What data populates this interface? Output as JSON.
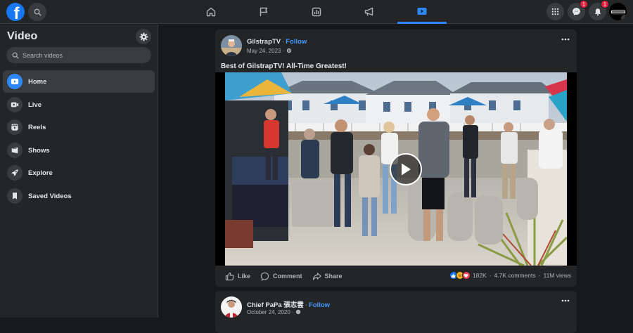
{
  "topbar": {
    "logo_letter": "f",
    "tabs": [
      {
        "name": "home",
        "active": false
      },
      {
        "name": "pages",
        "active": false
      },
      {
        "name": "ads-manager",
        "active": false
      },
      {
        "name": "campaigns",
        "active": false
      },
      {
        "name": "video",
        "active": true
      }
    ],
    "messenger_badge": "1",
    "notifications_badge": "1",
    "accent_color": "#2d88ff"
  },
  "sidebar": {
    "title": "Video",
    "search_placeholder": "Search videos",
    "items": [
      {
        "label": "Home",
        "icon": "video-home-icon",
        "active": true
      },
      {
        "label": "Live",
        "icon": "live-icon",
        "active": false
      },
      {
        "label": "Reels",
        "icon": "reels-icon",
        "active": false
      },
      {
        "label": "Shows",
        "icon": "shows-icon",
        "active": false
      },
      {
        "label": "Explore",
        "icon": "rocket-icon",
        "active": false
      },
      {
        "label": "Saved Videos",
        "icon": "bookmark-icon",
        "active": false
      }
    ]
  },
  "posts": [
    {
      "author": "GilstrapTV",
      "separator": "·",
      "follow": "Follow",
      "date": "May 24, 2023",
      "caption": "Best of GilstrapTV! All-Time Greatest!",
      "actions": {
        "like": "Like",
        "comment": "Comment",
        "share": "Share"
      },
      "reactions": "182K",
      "comments": "4.7K comments",
      "views": "11M views"
    },
    {
      "author": "Chief PaPa 張志雲",
      "separator": "·",
      "follow": "Follow",
      "date": "October 24, 2020"
    }
  ]
}
